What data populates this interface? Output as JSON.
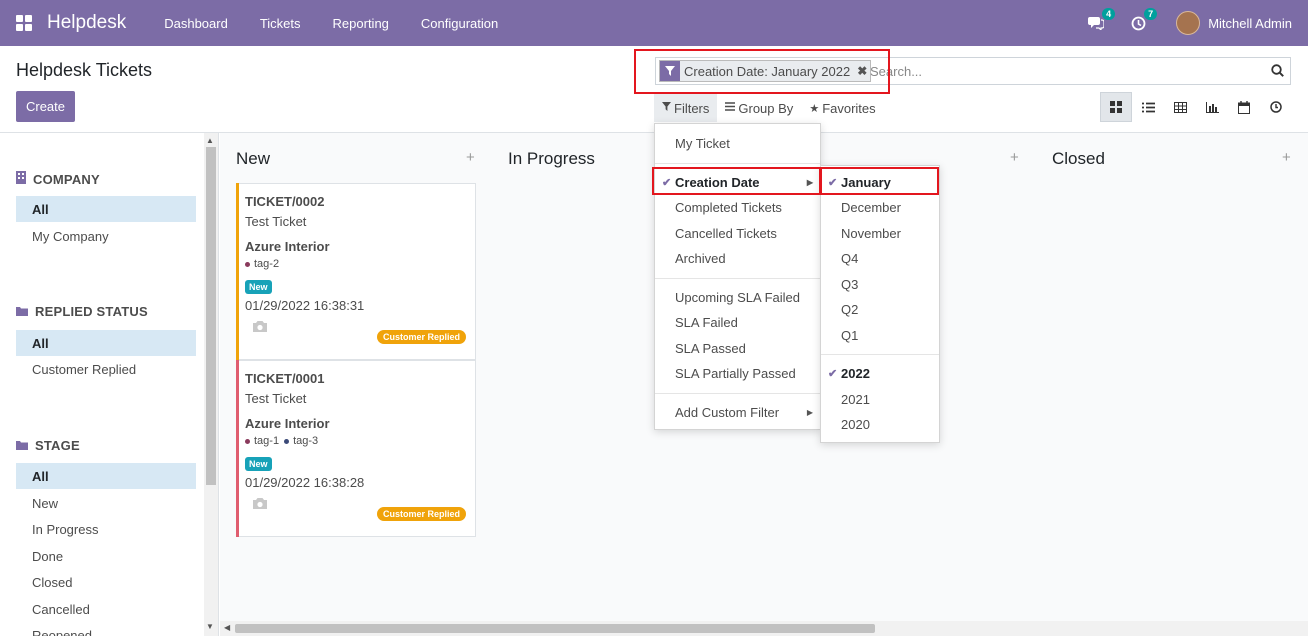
{
  "navbar": {
    "brand": "Helpdesk",
    "menu": [
      "Dashboard",
      "Tickets",
      "Reporting",
      "Configuration"
    ],
    "chat_count": "4",
    "activity_count": "7",
    "user_name": "Mitchell Admin",
    "bg_color": "#7c6ca6"
  },
  "control_panel": {
    "title": "Helpdesk Tickets",
    "create_label": "Create",
    "facet_label": "Creation Date: January 2022",
    "search_placeholder": "Search...",
    "filters_label": "Filters",
    "groupby_label": "Group By",
    "favorites_label": "Favorites",
    "views": [
      "kanban-icon",
      "list-icon",
      "pivot-icon",
      "graph-icon",
      "calendar-icon",
      "activity-icon"
    ]
  },
  "sidebar": {
    "sections": [
      {
        "title": "COMPANY",
        "icon": "building-icon",
        "items": [
          "All",
          "My Company"
        ]
      },
      {
        "title": "REPLIED STATUS",
        "icon": "folder-icon",
        "items": [
          "All",
          "Customer Replied"
        ]
      },
      {
        "title": "STAGE",
        "icon": "folder-icon",
        "items": [
          "All",
          "New",
          "In Progress",
          "Done",
          "Closed",
          "Cancelled",
          "Reopened"
        ]
      }
    ]
  },
  "kanban": {
    "columns": [
      "New",
      "In Progress",
      "Closed"
    ],
    "cards": [
      {
        "ref": "TICKET/0002",
        "name": "Test Ticket",
        "partner": "Azure Interior",
        "tags": [
          "tag-2"
        ],
        "stage": "New",
        "date": "01/29/2022 16:38:31",
        "badge": "Customer Replied",
        "stripe": "#f0a30a"
      },
      {
        "ref": "TICKET/0001",
        "name": "Test Ticket",
        "partner": "Azure Interior",
        "tags": [
          "tag-1",
          "tag-3"
        ],
        "stage": "New",
        "date": "01/29/2022 16:38:28",
        "badge": "Customer Replied",
        "stripe": "#e05d6f"
      }
    ]
  },
  "filters_menu": {
    "groups": [
      [
        "My Ticket"
      ],
      [
        "Creation Date",
        "Completed Tickets",
        "Cancelled Tickets",
        "Archived"
      ],
      [
        "Upcoming SLA Failed",
        "SLA Failed",
        "SLA Passed",
        "SLA Partially Passed"
      ],
      [
        "Add Custom Filter"
      ]
    ],
    "checked": "Creation Date"
  },
  "date_submenu": {
    "periods": [
      "January",
      "December",
      "November",
      "Q4",
      "Q3",
      "Q2",
      "Q1"
    ],
    "years": [
      "2022",
      "2021",
      "2020"
    ],
    "checked_period": "January",
    "checked_year": "2022"
  }
}
